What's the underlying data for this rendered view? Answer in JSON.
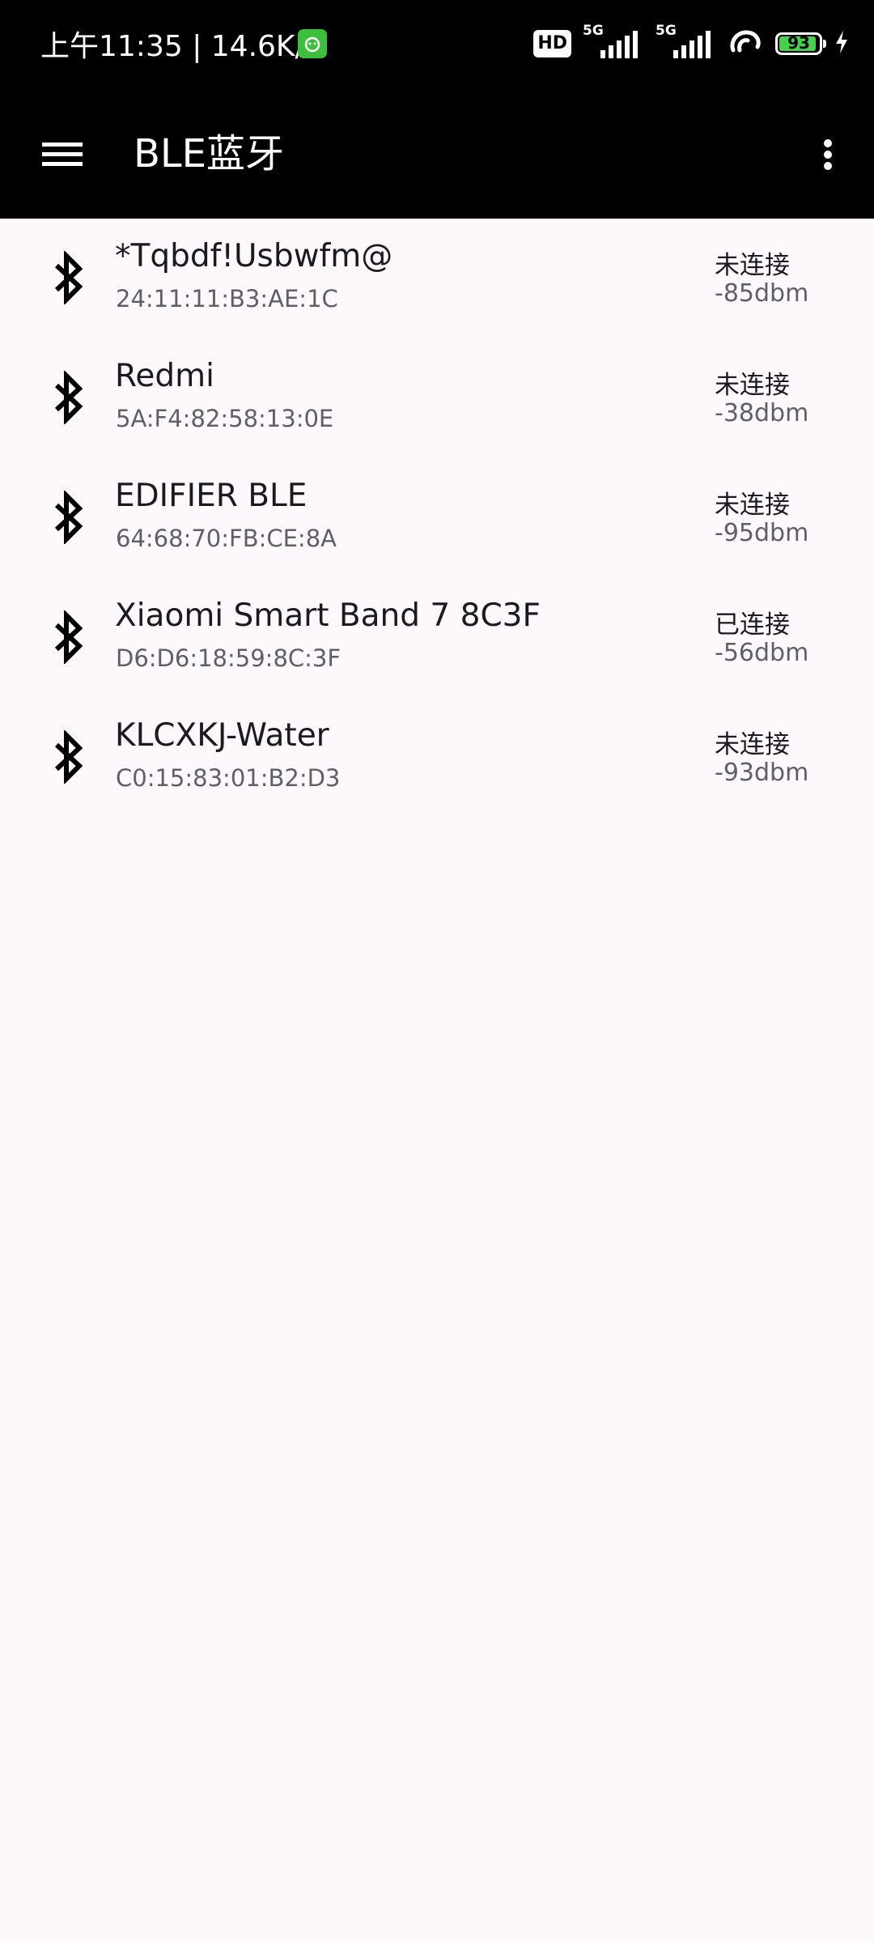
{
  "status_bar": {
    "time_speed": "上午11:35 | 14.6K/s",
    "hd_badge": "HD",
    "sim1_label": "5G",
    "sim2_label": "5G",
    "battery_percent": "93",
    "battery_level": 0.93,
    "charging": true
  },
  "app_bar": {
    "title": "BLE蓝牙",
    "menu_icon": "hamburger-menu-icon",
    "overflow_icon": "more-vertical-icon"
  },
  "devices": [
    {
      "name": "*Tqbdf!Usbwfm@",
      "mac": "24:11:11:B3:AE:1C",
      "status": "未连接",
      "rssi": "-85dbm"
    },
    {
      "name": "Redmi",
      "mac": "5A:F4:82:58:13:0E",
      "status": "未连接",
      "rssi": "-38dbm"
    },
    {
      "name": "EDIFIER BLE",
      "mac": "64:68:70:FB:CE:8A",
      "status": "未连接",
      "rssi": "-95dbm"
    },
    {
      "name": "Xiaomi Smart Band 7 8C3F",
      "mac": "D6:D6:18:59:8C:3F",
      "status": "已连接",
      "rssi": "-56dbm"
    },
    {
      "name": "KLCXKJ-Water",
      "mac": "C0:15:83:01:B2:D3",
      "status": "未连接",
      "rssi": "-93dbm"
    }
  ],
  "colors": {
    "app_bar_bg": "#000000",
    "page_bg": "#fdf8fc",
    "battery_fill": "#47d14b",
    "app_icon": "#3dbe3d"
  }
}
